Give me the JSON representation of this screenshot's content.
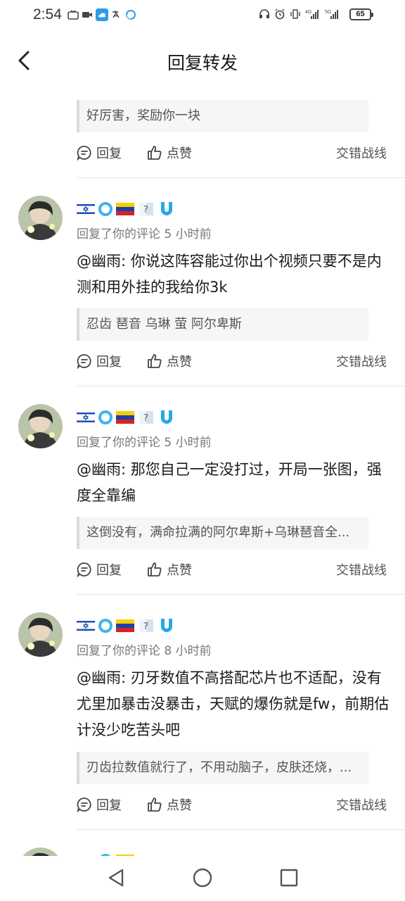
{
  "status_bar": {
    "time": "2:54",
    "battery": "65",
    "network_1": "4G",
    "network_2": "5G"
  },
  "header": {
    "title": "回复转发"
  },
  "first_item": {
    "quote": "好厉害，奖励你一块",
    "reply_label": "回复",
    "like_label": "点赞",
    "extra_label": "交错战线"
  },
  "comments": [
    {
      "meta": "回复了你的评论 5 小时前",
      "content": "@幽雨: 你说这阵容能过你出个视频只要不是内测和用外挂的我给你3k",
      "quote": "忍齿 琶音 乌琳 萤 阿尔卑斯",
      "reply_label": "回复",
      "like_label": "点赞",
      "extra_label": "交错战线"
    },
    {
      "meta": "回复了你的评论 5 小时前",
      "content": "@幽雨: 那您自己一定没打过，开局一张图，强度全靠编",
      "quote": "这倒没有，满命拉满的阿尔卑斯+乌琳琶音全...",
      "reply_label": "回复",
      "like_label": "点赞",
      "extra_label": "交错战线"
    },
    {
      "meta": "回复了你的评论 8 小时前",
      "content": "@幽雨: 刃牙数值不高搭配芯片也不适配，没有尤里加暴击没暴击，天赋的爆伤就是fw，前期估计没少吃苦头吧",
      "quote": "刃齿拉数值就行了，不用动脑子，皮肤还烧，...",
      "reply_label": "回复",
      "like_label": "点赞",
      "extra_label": "交错战线"
    }
  ],
  "icons": {
    "back": "chevron-left-icon",
    "reply": "comment-bubble-icon",
    "like": "thumbs-up-icon",
    "nav_back": "triangle-back-icon",
    "nav_home": "circle-home-icon",
    "nav_recent": "square-recent-icon"
  },
  "colors": {
    "accent_blue": "#2b9bea",
    "text_primary": "#1a1a1a",
    "text_secondary": "#777777"
  }
}
